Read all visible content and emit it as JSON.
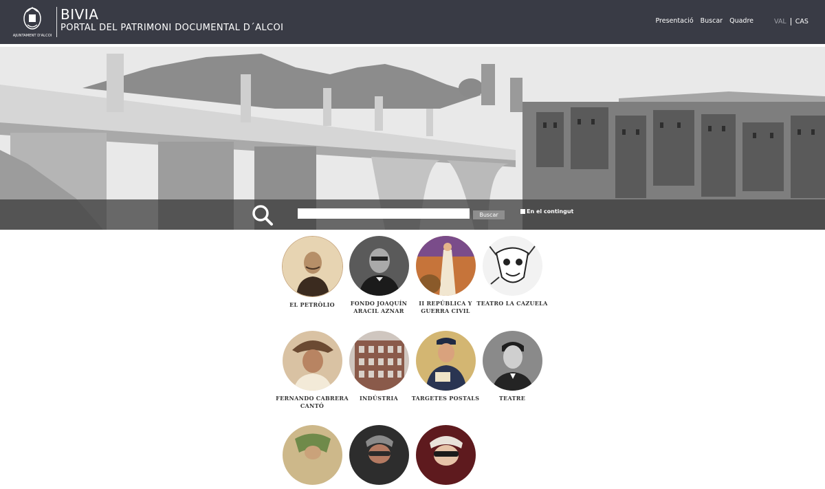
{
  "header": {
    "logo_caption": "AJUNTAMENT D'ALCOI",
    "title": "BIVIA",
    "subtitle": "PORTAL DEL PATRIMONI DOCUMENTAL D´ALCOI",
    "nav": [
      "Presentació",
      "Buscar",
      "Quadre"
    ],
    "languages": {
      "val": "VAL",
      "cas": "CAS",
      "active": "CAS"
    }
  },
  "search": {
    "input_value": "",
    "button_label": "Buscar",
    "checkbox_label": "En el contingut",
    "checkbox_checked": false
  },
  "collections": [
    {
      "label": "EL PETRÒLIO",
      "tone": "#b89470"
    },
    {
      "label": "FONDO JOAQUÍN ARACIL AZNAR",
      "tone": "#3a3a3a"
    },
    {
      "label": "II REPÚBLICA Y GUERRA CIVIL",
      "tone": "#c27a3e"
    },
    {
      "label": "TEATRO LA CAZUELA",
      "tone": "#e6e6e6"
    },
    {
      "label": "FERNANDO CABRERA CANTÓ",
      "tone": "#a97a5a"
    },
    {
      "label": "INDÚSTRIA",
      "tone": "#8b5a48"
    },
    {
      "label": "TARGETES POSTALS",
      "tone": "#c9a860"
    },
    {
      "label": "TEATRE",
      "tone": "#6f6f6f"
    },
    {
      "label": "",
      "tone": "#a58a55"
    },
    {
      "label": "",
      "tone": "#6b3e34"
    },
    {
      "label": "",
      "tone": "#7a1e24"
    }
  ]
}
